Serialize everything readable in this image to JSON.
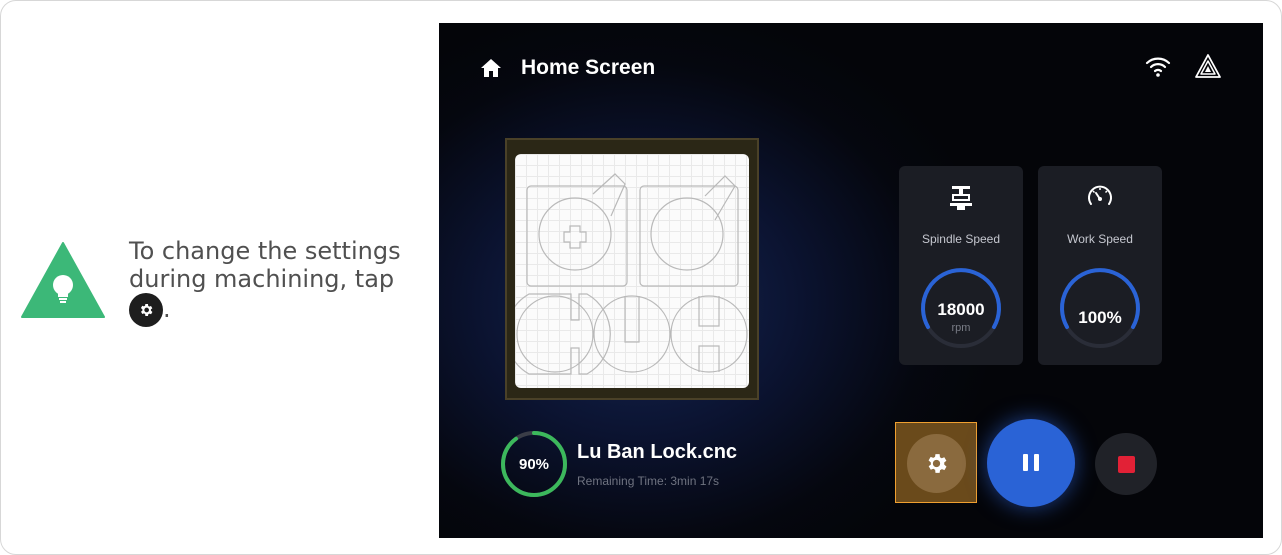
{
  "tip": {
    "text": "To change the settings during machining, tap",
    "suffix": ".",
    "icon_name": "lightbulb-icon",
    "accent": "#3cb878"
  },
  "header": {
    "title": "Home Screen",
    "icons": [
      "home-icon",
      "wifi-icon",
      "brand-logo-icon"
    ]
  },
  "spindle": {
    "label": "Spindle Speed",
    "value": "18000",
    "unit": "rpm",
    "icon_name": "spindle-icon"
  },
  "work_speed": {
    "label": "Work Speed",
    "value": "100%",
    "icon_name": "speedometer-icon"
  },
  "job": {
    "progress_text": "90%",
    "progress": 0.9,
    "name": "Lu Ban Lock.cnc",
    "remaining": "Remaining Time: 3min 17s"
  },
  "controls": {
    "settings_icon": "gear-icon",
    "pause_icon": "pause-icon",
    "stop_icon": "stop-icon"
  },
  "colors": {
    "gauge_arc": "#2a63d6",
    "progress_ring": "#3cb85c",
    "highlight": "#f0a030",
    "stop": "#e22136"
  }
}
